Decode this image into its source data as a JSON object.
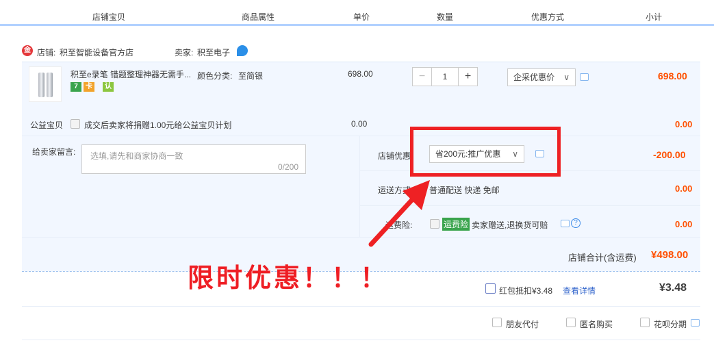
{
  "columns": [
    "店铺宝贝",
    "商品属性",
    "单价",
    "数量",
    "优惠方式",
    "小计"
  ],
  "shop": {
    "icon_text": "金",
    "store_label": "店铺:",
    "store_name": "积至智能设备官方店",
    "seller_label": "卖家:",
    "seller_name": "积至电子"
  },
  "item": {
    "title": "积至e录笔 错题整理神器无需手...",
    "attr_label": "颜色分类:",
    "attr_value": "至简银",
    "price": "698.00",
    "quantity": "1",
    "discount_select": "企采优惠价",
    "subtotal": "698.00",
    "tags": [
      "7",
      "卡",
      "认"
    ]
  },
  "charity": {
    "label": "公益宝贝",
    "text": "成交后卖家将捐赠1.00元给公益宝贝计划",
    "price": "0.00",
    "subtotal": "0.00"
  },
  "message": {
    "label": "给卖家留言:",
    "placeholder": "选填,请先和商家协商一致",
    "counter": "0/200"
  },
  "store_coupon": {
    "label": "店铺优惠:",
    "select": "省200元:推广优惠",
    "amount": "-200.00"
  },
  "shipping": {
    "label": "运送方式:",
    "value": "普通配送 快递 免邮",
    "amount": "0.00"
  },
  "insurance": {
    "label": "运费险:",
    "badge": "运费险",
    "text": "卖家赠送,退换货可赔",
    "amount": "0.00"
  },
  "store_total": {
    "label": "店铺合计(含运费)",
    "amount": "¥498.00"
  },
  "redpacket": {
    "label": "红包抵扣¥3.48",
    "link": "查看详情",
    "amount": "¥3.48"
  },
  "options": [
    "朋友代付",
    "匿名购买",
    "花呗分期"
  ],
  "promo_text": "限时优惠！！！",
  "colors": {
    "accent": "#ff5000",
    "highlight": "#ee2124",
    "link": "#3366cc"
  }
}
